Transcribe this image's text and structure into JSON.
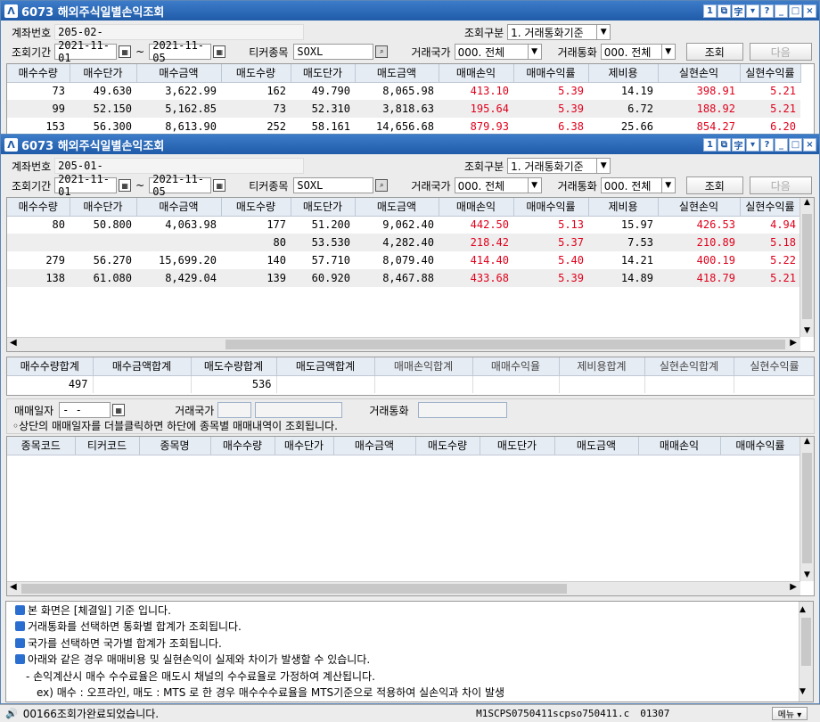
{
  "window": {
    "title": "6073 해외주식일별손익조회",
    "title_buttons": [
      "1",
      "⧉",
      "字",
      "▾",
      "?",
      "_",
      "□",
      "×"
    ]
  },
  "form": {
    "account_label": "계좌번호",
    "account_back": "205-02-",
    "account_front": "205-01-",
    "period_label": "조회기간",
    "date_from": "2021-11-01",
    "tilde": "~",
    "date_to": "2021-11-05",
    "ticker_label": "티커종목",
    "ticker_value": "SOXL",
    "query_type_label": "조회구분",
    "query_type_value": "1. 거래통화기준",
    "country_label": "거래국가",
    "country_value": "000. 전체",
    "currency_label": "거래통화",
    "currency_value": "000. 전체",
    "search_button": "조회",
    "next_button": "다음"
  },
  "grid": {
    "headers": [
      "매수수량",
      "매수단가",
      "매수금액",
      "매도수량",
      "매도단가",
      "매도금액",
      "매매손익",
      "매매수익률",
      "제비용",
      "실현손익",
      "실현수익률"
    ],
    "back_rows": [
      [
        "73",
        "49.630",
        "3,622.99",
        "162",
        "49.790",
        "8,065.98",
        "413.10",
        "5.39",
        "14.19",
        "398.91",
        "5.21"
      ],
      [
        "99",
        "52.150",
        "5,162.85",
        "73",
        "52.310",
        "3,818.63",
        "195.64",
        "5.39",
        "6.72",
        "188.92",
        "5.21"
      ],
      [
        "153",
        "56.300",
        "8,613.90",
        "252",
        "58.161",
        "14,656.68",
        "879.93",
        "6.38",
        "25.66",
        "854.27",
        "6.20"
      ]
    ],
    "front_rows": [
      [
        "80",
        "50.800",
        "4,063.98",
        "177",
        "51.200",
        "9,062.40",
        "442.50",
        "5.13",
        "15.97",
        "426.53",
        "4.94"
      ],
      [
        "",
        "",
        "",
        "80",
        "53.530",
        "4,282.40",
        "218.42",
        "5.37",
        "7.53",
        "210.89",
        "5.18"
      ],
      [
        "279",
        "56.270",
        "15,699.20",
        "140",
        "57.710",
        "8,079.40",
        "414.40",
        "5.40",
        "14.21",
        "400.19",
        "5.22"
      ],
      [
        "138",
        "61.080",
        "8,429.04",
        "139",
        "60.920",
        "8,467.88",
        "433.68",
        "5.39",
        "14.89",
        "418.79",
        "5.21"
      ]
    ]
  },
  "summary": {
    "headers": [
      "매수수량합계",
      "매수금액합계",
      "매도수량합계",
      "매도금액합계",
      "매매손익합계",
      "매매수익율",
      "제비용합계",
      "실현손익합계",
      "실현수익률"
    ],
    "values": [
      "497",
      "",
      "536",
      "",
      "",
      "",
      "",
      "",
      ""
    ]
  },
  "detail_filter": {
    "date_label": "매매일자",
    "date_value": "  -  -  ",
    "country_label": "거래국가",
    "currency_label": "거래통화",
    "hint": "◦상단의 매매일자를 더블클릭하면 하단에 종목별 매매내역이 조회됩니다."
  },
  "detail_grid": {
    "headers": [
      "종목코드",
      "티커코드",
      "종목명",
      "매수수량",
      "매수단가",
      "매수금액",
      "매도수량",
      "매도단가",
      "매도금액",
      "매매손익",
      "매매수익률"
    ]
  },
  "notes": [
    "본 화면은 [체결일] 기준 입니다.",
    "거래통화를 선택하면 통화별 합계가 조회됩니다.",
    "국가를 선택하면 국가별 합계가 조회됩니다.",
    "아래와 같은 경우 매매비용 및 실현손익이 실제와 차이가 발생할 수 있습니다.",
    "- 손익계산시 매수 수수료율은 매도시 채널의 수수료율로 가정하여 계산됩니다.",
    "ex) 매수 : 오프라인, 매도 : MTS 로 한 경우  매수수수료율을 MTS기준으로 적용하여 실손익과 차이 발생"
  ],
  "status": {
    "message": "00166조회가완료되었습니다.",
    "source": "M1SCPS0750411scpso750411.c",
    "code": "01307",
    "menu_button": "메뉴 ▾"
  },
  "colors": {
    "loss_profit": "#e0001b",
    "title_bar": "#1f5ba8"
  }
}
